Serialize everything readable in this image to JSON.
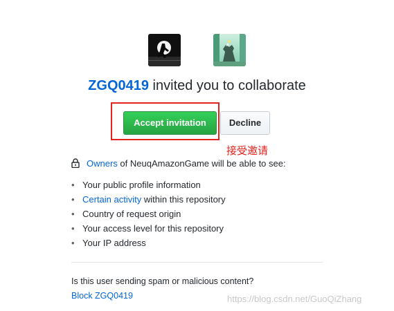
{
  "invitation": {
    "inviter": "ZGQ0419",
    "headline_rest": " invited you to collaborate"
  },
  "actions": {
    "accept_label": "Accept invitation",
    "decline_label": "Decline"
  },
  "annotation": "接受邀请",
  "permissions": {
    "owners_link": "Owners",
    "intro_rest": " of NeuqAmazonGame will be able to see:",
    "items": [
      {
        "text": "Your public profile information"
      },
      {
        "link": "Certain activity",
        "text": " within this repository"
      },
      {
        "text": "Country of request origin"
      },
      {
        "text": "Your access level for this repository"
      },
      {
        "text": "Your IP address"
      }
    ]
  },
  "report": {
    "question": "Is this user sending spam or malicious content?",
    "block_link": "Block ZGQ0419"
  },
  "watermark": "https://blog.csdn.net/GuoQiZhang",
  "icons": [
    "lock-icon",
    "inviter-avatar",
    "repository-avatar"
  ],
  "colors": {
    "link": "#0366d6",
    "accept_button": "#28a745",
    "highlight": "#e3221b"
  }
}
